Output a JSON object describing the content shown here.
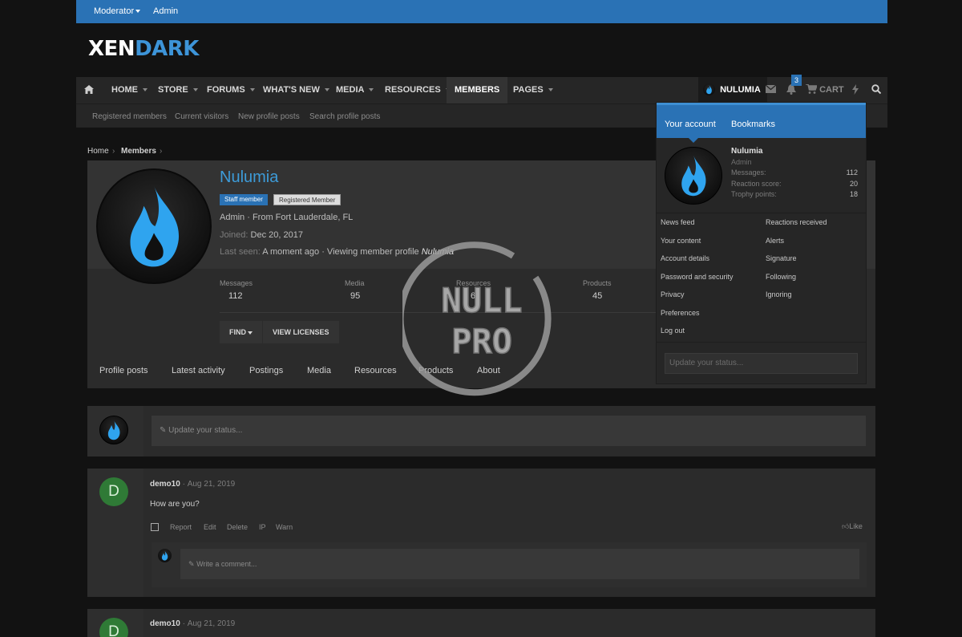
{
  "topbar": {
    "moderator": "Moderator",
    "admin": "Admin"
  },
  "logo": {
    "part1": "XEN",
    "part2": "DARK"
  },
  "nav": {
    "home": "HOME",
    "store": "STORE",
    "forums": "FORUMS",
    "whats_new": "WHAT'S NEW",
    "media": "MEDIA",
    "resources": "RESOURCES",
    "members": "MEMBERS",
    "pages": "PAGES",
    "user": "NULUMIA",
    "alerts_count": "3",
    "cart": "CART"
  },
  "subnav": [
    "Registered members",
    "Current visitors",
    "New profile posts",
    "Search profile posts"
  ],
  "breadcrumb": {
    "home": "Home",
    "members": "Members"
  },
  "profile": {
    "name": "Nulumia",
    "badge_staff": "Staff member",
    "badge_reg": "Registered Member",
    "location": "Admin · From Fort Lauderdale, FL",
    "joined_label": "Joined:",
    "joined": "Dec 20, 2017",
    "lastseen_label": "Last seen:",
    "lastseen": "A moment ago · Viewing member profile",
    "lastseen_name": "Nulumia",
    "stats": [
      {
        "label": "Messages",
        "value": "112"
      },
      {
        "label": "Media",
        "value": "95"
      },
      {
        "label": "Resources",
        "value": "6"
      },
      {
        "label": "Products",
        "value": "45"
      }
    ],
    "find": "FIND",
    "view_licenses": "VIEW LICENSES",
    "tabs": [
      "Profile posts",
      "Latest activity",
      "Postings",
      "Media",
      "Resources",
      "Products",
      "About"
    ]
  },
  "status_placeholder": "Update your status...",
  "posts": [
    {
      "initial": "D",
      "author": "demo10",
      "date": "Aug 21, 2019",
      "text": "How are you?",
      "actions": [
        "Report",
        "Edit",
        "Delete",
        "IP",
        "Warn"
      ],
      "like": "Like",
      "comment_placeholder": "Write a comment..."
    },
    {
      "initial": "D",
      "author": "demo10",
      "date": "Aug 21, 2019"
    }
  ],
  "menu": {
    "tab_account": "Your account",
    "tab_bookmarks": "Bookmarks",
    "name": "Nulumia",
    "role": "Admin",
    "stats": [
      {
        "label": "Messages:",
        "value": "112"
      },
      {
        "label": "Reaction score:",
        "value": "20"
      },
      {
        "label": "Trophy points:",
        "value": "18"
      }
    ],
    "links_left": [
      "News feed",
      "Your content",
      "Account details",
      "Password and security",
      "Privacy",
      "Preferences",
      "Log out"
    ],
    "links_right": [
      "Reactions received",
      "Alerts",
      "Signature",
      "Following",
      "Ignoring"
    ],
    "status_placeholder": "Update your status..."
  },
  "watermark": {
    "line1": "NULL",
    "line2": "PRO"
  },
  "colors": {
    "accent": "#2a72b5",
    "link": "#3d9bd8",
    "page_bg": "#121212",
    "panel_bg": "#2b2b2b"
  }
}
